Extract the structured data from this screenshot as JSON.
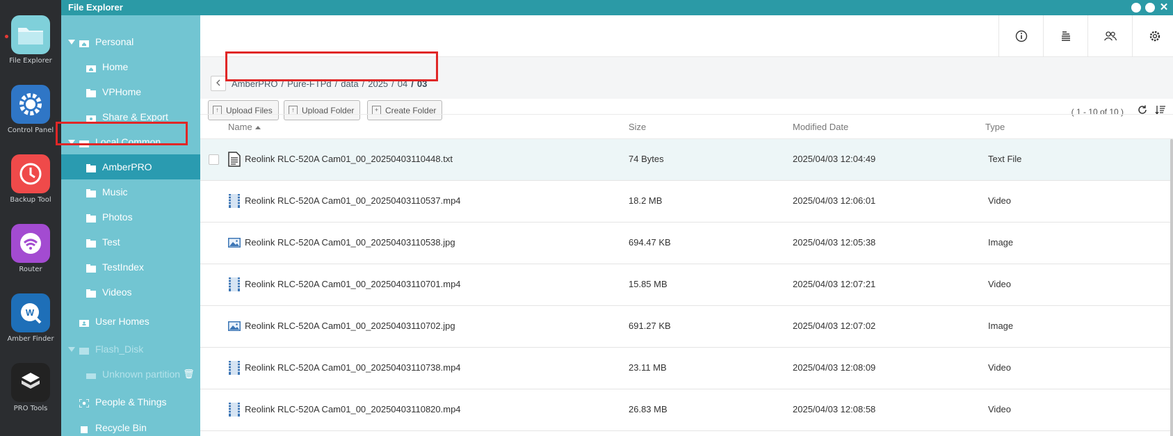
{
  "dock": {
    "apps": [
      {
        "label": "File Explorer",
        "icon": "folder-icon",
        "color": "#7fd0da"
      },
      {
        "label": "Control Panel",
        "icon": "gear-icon",
        "color": "#2f76c6"
      },
      {
        "label": "Backup Tool",
        "icon": "clock-icon",
        "color": "#ef4a4a"
      },
      {
        "label": "Router",
        "icon": "wifi-icon",
        "color": "#a34bd1"
      },
      {
        "label": "Amber Finder",
        "icon": "finder-icon",
        "color": "#1e6fb8"
      },
      {
        "label": "PRO Tools",
        "icon": "box-icon",
        "color": "#222222"
      }
    ]
  },
  "window": {
    "title": "File Explorer"
  },
  "sidebar": {
    "personal": "Personal",
    "home": "Home",
    "vphome": "VPHome",
    "share_export": "Share & Export",
    "local_common": "Local Common",
    "amberpro": "AmberPRO",
    "music": "Music",
    "photos": "Photos",
    "test": "Test",
    "testindex": "TestIndex",
    "videos": "Videos",
    "user_homes": "User Homes",
    "flash_disk": "Flash_Disk",
    "unknown_partition": "Unknown partition",
    "people_things": "People & Things",
    "recycle_bin": "Recycle Bin"
  },
  "breadcrumb": {
    "items": [
      "AmberPRO",
      "Pure-FTPd",
      "data",
      "2025",
      "04"
    ],
    "separator": "/",
    "current": "03"
  },
  "actions": {
    "upload_files": "Upload Files",
    "upload_folder": "Upload Folder",
    "create_folder": "Create Folder",
    "count": "( 1 - 10 of 10 )"
  },
  "table": {
    "columns": {
      "name": "Name",
      "size": "Size",
      "modified": "Modified Date",
      "type": "Type"
    },
    "rows": [
      {
        "name": "Reolink RLC-520A Cam01_00_20250403110448.txt",
        "size": "74 Bytes",
        "modified": "2025/04/03 12:04:49",
        "type": "Text File",
        "icon": "text-file-icon"
      },
      {
        "name": "Reolink RLC-520A Cam01_00_20250403110537.mp4",
        "size": "18.2 MB",
        "modified": "2025/04/03 12:06:01",
        "type": "Video",
        "icon": "video-file-icon"
      },
      {
        "name": "Reolink RLC-520A Cam01_00_20250403110538.jpg",
        "size": "694.47 KB",
        "modified": "2025/04/03 12:05:38",
        "type": "Image",
        "icon": "image-file-icon"
      },
      {
        "name": "Reolink RLC-520A Cam01_00_20250403110701.mp4",
        "size": "15.85 MB",
        "modified": "2025/04/03 12:07:21",
        "type": "Video",
        "icon": "video-file-icon"
      },
      {
        "name": "Reolink RLC-520A Cam01_00_20250403110702.jpg",
        "size": "691.27 KB",
        "modified": "2025/04/03 12:07:02",
        "type": "Image",
        "icon": "image-file-icon"
      },
      {
        "name": "Reolink RLC-520A Cam01_00_20250403110738.mp4",
        "size": "23.11 MB",
        "modified": "2025/04/03 12:08:09",
        "type": "Video",
        "icon": "video-file-icon"
      },
      {
        "name": "Reolink RLC-520A Cam01_00_20250403110820.mp4",
        "size": "26.83 MB",
        "modified": "2025/04/03 12:08:58",
        "type": "Video",
        "icon": "video-file-icon"
      }
    ]
  },
  "colors": {
    "accent": "#2b9aa6",
    "sidebar": "#72c5d2",
    "active": "#2a9bb0",
    "highlight_box": "#e02727"
  }
}
